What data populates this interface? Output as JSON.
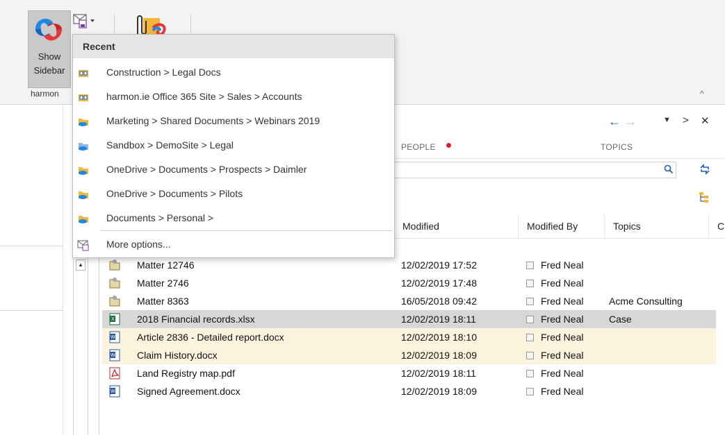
{
  "ribbon": {
    "show_sidebar_label_1": "Show",
    "show_sidebar_label_2": "Sidebar",
    "group_label": "harmon",
    "collapse_glyph": "^"
  },
  "nav": {
    "back_glyph": "←",
    "forward_glyph": "→",
    "dropdown_glyph": "▼",
    "next_glyph": ">",
    "close_glyph": "✕"
  },
  "tabs": {
    "people": "PEOPLE",
    "topics": "TOPICS"
  },
  "table": {
    "headers": {
      "modified": "Modified",
      "modified_by": "Modified By",
      "topics": "Topics",
      "extra": "C"
    },
    "rows": [
      {
        "name": "Matter 12746",
        "modified": "12/02/2019 17:52",
        "by": "Fred Neal",
        "topic": "",
        "icon": "folder-icon"
      },
      {
        "name": "Matter 2746",
        "modified": "12/02/2019 17:48",
        "by": "Fred Neal",
        "topic": "",
        "icon": "folder-icon"
      },
      {
        "name": "Matter 8363",
        "modified": "16/05/2018 09:42",
        "by": "Fred Neal",
        "topic": "Acme Consulting",
        "icon": "folder-icon"
      },
      {
        "name": "2018 Financial records.xlsx",
        "modified": "12/02/2019 18:11",
        "by": "Fred Neal",
        "topic": "Case",
        "icon": "excel-icon"
      },
      {
        "name": "Article 2836 - Detailed report.docx",
        "modified": "12/02/2019 18:10",
        "by": "Fred Neal",
        "topic": "",
        "icon": "word-icon"
      },
      {
        "name": "Claim History.docx",
        "modified": "12/02/2019 18:09",
        "by": "Fred Neal",
        "topic": "",
        "icon": "word-icon"
      },
      {
        "name": "Land Registry map.pdf",
        "modified": "12/02/2019 18:11",
        "by": "Fred Neal",
        "topic": "",
        "icon": "pdf-icon"
      },
      {
        "name": "Signed Agreement.docx",
        "modified": "12/02/2019 18:09",
        "by": "Fred Neal",
        "topic": "",
        "icon": "word-icon"
      }
    ]
  },
  "dropdown": {
    "header": "Recent",
    "items": [
      {
        "label": "Construction > Legal Docs",
        "icon": "sharepoint-site-icon"
      },
      {
        "label": "harmon.ie Office 365 Site > Sales > Accounts",
        "icon": "sharepoint-site-icon"
      },
      {
        "label": "Marketing > Shared Documents > Webinars 2019",
        "icon": "cloud-folder-icon"
      },
      {
        "label": "Sandbox > DemoSite > Legal",
        "icon": "cloud-folder-icon"
      },
      {
        "label": "OneDrive > Documents > Prospects > Daimler",
        "icon": "cloud-folder-icon"
      },
      {
        "label": "OneDrive > Documents > Pilots",
        "icon": "cloud-folder-icon"
      },
      {
        "label": "Documents > Personal >",
        "icon": "cloud-folder-icon"
      }
    ],
    "more_options": "More options..."
  },
  "colors": {
    "accent_blue": "#1a5fb4",
    "highlight_row": "#fbf3de",
    "selected_row": "#d7d7d7",
    "people_dot": "#e0212b"
  }
}
